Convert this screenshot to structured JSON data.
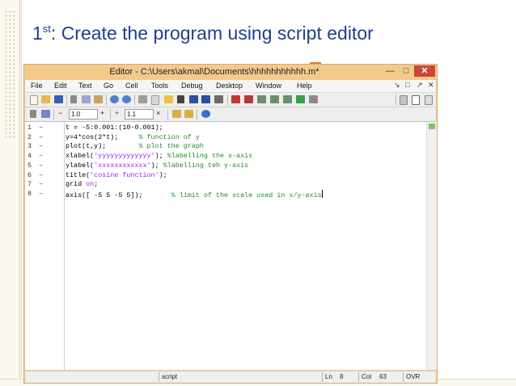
{
  "slide": {
    "title_prefix": "1",
    "title_sup": "st",
    "title_rest": ": Create the program using script editor"
  },
  "window": {
    "title": "Editor - C:\\Users\\akmal\\Documents\\hhhhhhhhhhh.m*",
    "minimize": "—",
    "maximize": "□",
    "close": "✕"
  },
  "menu": {
    "items": [
      "File",
      "Edit",
      "Text",
      "Go",
      "Cell",
      "Tools",
      "Debug",
      "Desktop",
      "Window",
      "Help"
    ],
    "right_icons": [
      "↘",
      "□",
      "↗",
      "✕"
    ]
  },
  "toolbar2": {
    "minus": "−",
    "value1": "1.0",
    "plus": "+",
    "divide": "÷",
    "value2": "1.1",
    "times": "×"
  },
  "code_lines": [
    {
      "num": "1",
      "parts": [
        {
          "t": "t = -5:0.001:(10-0.001);",
          "c": "code"
        }
      ]
    },
    {
      "num": "2",
      "parts": [
        {
          "t": "y=4*cos(2*t);     ",
          "c": "code"
        },
        {
          "t": "% function of y",
          "c": "cm"
        }
      ]
    },
    {
      "num": "3",
      "parts": [
        {
          "t": "plot(t,y);        ",
          "c": "code"
        },
        {
          "t": "% plot the graph",
          "c": "cm"
        }
      ]
    },
    {
      "num": "4",
      "parts": [
        {
          "t": "xlabel(",
          "c": "code"
        },
        {
          "t": "'yyyyyyyyyyyyy'",
          "c": "str"
        },
        {
          "t": "); ",
          "c": "code"
        },
        {
          "t": "%labelling the x-axis",
          "c": "cm"
        }
      ]
    },
    {
      "num": "5",
      "parts": [
        {
          "t": "ylabel(",
          "c": "code"
        },
        {
          "t": "'xxxxxxxxxxxx'",
          "c": "str"
        },
        {
          "t": "); ",
          "c": "code"
        },
        {
          "t": "%labelling teh y-axis",
          "c": "cm"
        }
      ]
    },
    {
      "num": "6",
      "parts": [
        {
          "t": "title(",
          "c": "code"
        },
        {
          "t": "'cosine function'",
          "c": "str"
        },
        {
          "t": ");",
          "c": "code"
        }
      ]
    },
    {
      "num": "7",
      "parts": [
        {
          "t": "grid ",
          "c": "code"
        },
        {
          "t": "on",
          "c": "str"
        },
        {
          "t": ";",
          "c": "code"
        }
      ]
    },
    {
      "num": "8",
      "parts": [
        {
          "t": "axis([ -5 5 -5 5]);       ",
          "c": "code"
        },
        {
          "t": "% limit of the scale used in x/y-axis",
          "c": "cm"
        }
      ]
    }
  ],
  "status": {
    "mode": "script",
    "ln_label": "Ln",
    "ln_value": "8",
    "col_label": "Col",
    "col_value": "63",
    "ovr": "OVR"
  },
  "colors": {
    "title_blue": "#1f3f8f",
    "window_frame": "#f4c98c",
    "comment_green": "#228b22",
    "string_purple": "#a020f0"
  }
}
